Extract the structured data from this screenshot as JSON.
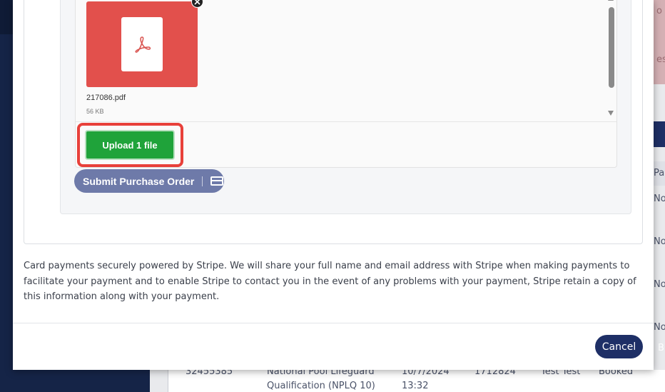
{
  "background": {
    "alert_line_1": "o",
    "alert_line_2": "es i",
    "col_header": "Pai",
    "row_cells": [
      "No",
      "No",
      "No",
      "No"
    ],
    "right_button": "B",
    "table_row": {
      "id": "32455385",
      "course_line_1": "National Pool Lifeguard",
      "course_line_2": "Qualification (NPLQ 10)",
      "date": "10/7/2024",
      "time": "13:32",
      "number": "1712824",
      "name": "Test Test",
      "status": "Booked"
    }
  },
  "uploader": {
    "file_name": "217086.pdf",
    "file_size": "56 KB",
    "upload_label": "Upload 1 file",
    "file_icon": "pdf-icon",
    "remove_icon": "close-icon"
  },
  "submit": {
    "label": "Submit Purchase Order",
    "icon": "credit-card-icon"
  },
  "stripe_notice": "Card payments securely powered by Stripe. We will share your full name and email address with Stripe when making payments to facilitate your payment and to enable Stripe to contact you in the event of any problems with your payment, Stripe retain a copy of this information along with your payment.",
  "footer": {
    "cancel_label": "Cancel"
  },
  "colors": {
    "file_tile": "#e2504c",
    "upload_button": "#1fa33a",
    "highlight": "#e8403a",
    "submit_button": "#6e7aa9",
    "cancel_button": "#1e2f66"
  }
}
